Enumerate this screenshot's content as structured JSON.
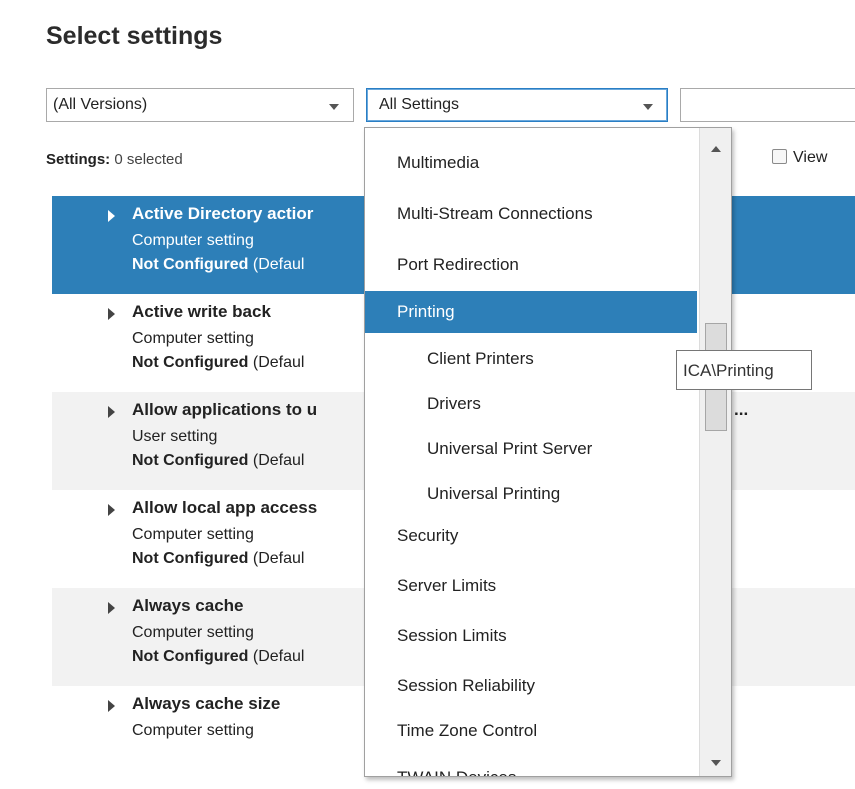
{
  "page_title": "Select settings",
  "filters": {
    "version_value": "(All Versions)",
    "category_value": "All Settings",
    "search_value": ""
  },
  "settings_count": {
    "label": "Settings:",
    "value": "0 selected"
  },
  "view_toggle_label": "View",
  "settings": [
    {
      "name": "Active Directory actior",
      "scope": "Computer setting",
      "state": "Not Configured",
      "state_suffix": "(Defaul"
    },
    {
      "name": "Active write back",
      "scope": "Computer setting",
      "state": "Not Configured",
      "state_suffix": "(Defaul"
    },
    {
      "name": "Allow applications to u",
      "scope": "User setting",
      "state": "Not Configured",
      "state_suffix": "(Defaul"
    },
    {
      "name": "Allow local app access",
      "scope": "Computer setting",
      "state": "Not Configured",
      "state_suffix": "(Defaul"
    },
    {
      "name": "Always cache",
      "scope": "Computer setting",
      "state": "Not Configured",
      "state_suffix": "(Defaul"
    },
    {
      "name": "Always cache size",
      "scope": "Computer setting",
      "state": "",
      "state_suffix": ""
    }
  ],
  "row_overflow_text": "...",
  "dropdown": {
    "items": [
      {
        "label": "Multimedia",
        "level": 0
      },
      {
        "label": "Multi-Stream Connections",
        "level": 0
      },
      {
        "label": "Port Redirection",
        "level": 0
      },
      {
        "label": "Printing",
        "level": 0,
        "highlighted": true
      },
      {
        "label": "Client Printers",
        "level": 1
      },
      {
        "label": "Drivers",
        "level": 1
      },
      {
        "label": "Universal Print Server",
        "level": 1
      },
      {
        "label": "Universal Printing",
        "level": 1
      },
      {
        "label": "Security",
        "level": 0
      },
      {
        "label": "Server Limits",
        "level": 0
      },
      {
        "label": "Session Limits",
        "level": 0
      },
      {
        "label": "Session Reliability",
        "level": 0
      },
      {
        "label": "Time Zone Control",
        "level": 0
      },
      {
        "label": "TWAIN Devices",
        "level": 0
      }
    ]
  },
  "tooltip_text": "ICA\\Printing",
  "colors": {
    "accent": "#2d7fb8",
    "alt_row": "#f2f2f2"
  }
}
